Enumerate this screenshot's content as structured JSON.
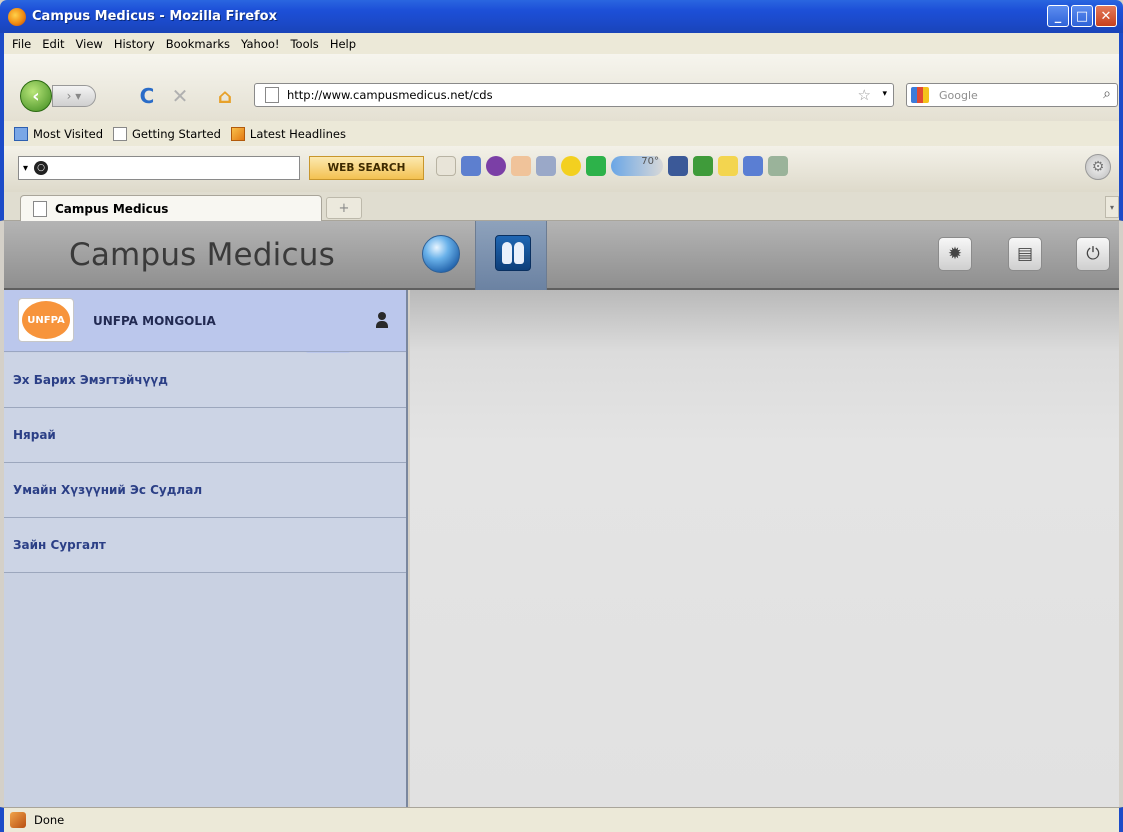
{
  "window": {
    "title": "Campus Medicus - Mozilla Firefox"
  },
  "menu": [
    "File",
    "Edit",
    "View",
    "History",
    "Bookmarks",
    "Yahoo!",
    "Tools",
    "Help"
  ],
  "address": {
    "url": "http://www.campusmedicus.net/cds"
  },
  "search": {
    "placeholder": "Google"
  },
  "bookmarks": [
    "Most Visited",
    "Getting Started",
    "Latest Headlines"
  ],
  "yahoo_toolbar": {
    "button": "WEB SEARCH",
    "weather": "70°"
  },
  "tab": {
    "title": "Campus Medicus"
  },
  "app": {
    "title": "Campus Medicus",
    "profile_name": "UNFPA MONGOLIA",
    "logo_text": "UNFPA",
    "nav": [
      "Эх Барих Эмэгтэйчүүд",
      "Нярай",
      "Умайн Хүзүүний Эс Судлал",
      "Зайн Сургалт"
    ]
  },
  "status": {
    "text": "Done"
  },
  "colors": {
    "accent": "#1c4bc8",
    "header": "#a0a0a0",
    "sidebar": "#c9d1e2",
    "profile": "#bbc7ec",
    "nav_text": "#2b3f86"
  }
}
